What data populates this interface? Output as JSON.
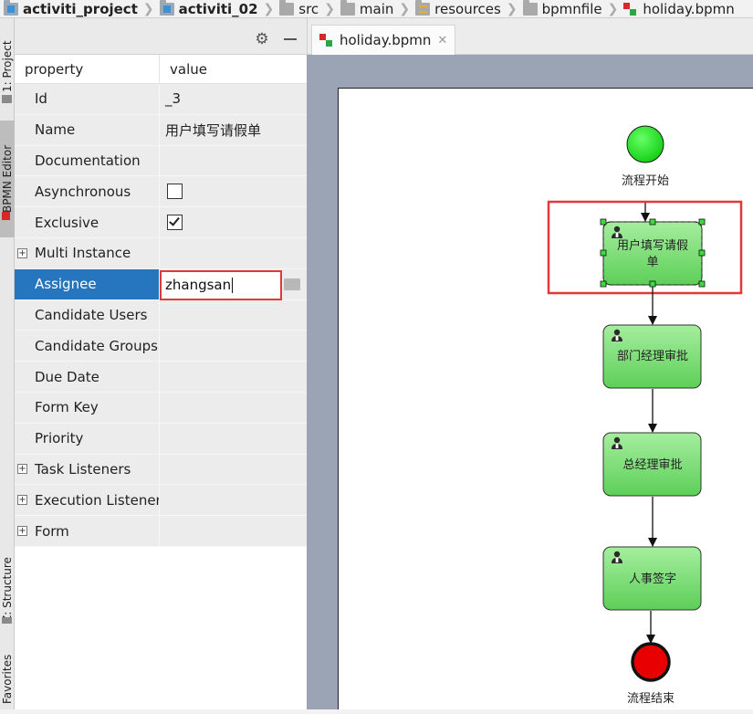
{
  "breadcrumb": {
    "items": [
      "activiti_project",
      "activiti_02",
      "src",
      "main",
      "resources",
      "bpmnfile",
      "holiday.bpmn"
    ]
  },
  "toolstrip": {
    "project_tab": "1: Project",
    "bpmn_editor_tab": "BPMN Editor",
    "structure_tab": "Z: Structure",
    "favorites_tab": "Favorites"
  },
  "properties": {
    "header_property": "property",
    "header_value": "value",
    "rows": [
      {
        "label": "Id",
        "value": "_3"
      },
      {
        "label": "Name",
        "value": "用户填写请假单"
      },
      {
        "label": "Documentation",
        "value": ""
      },
      {
        "label": "Asynchronous",
        "value": ""
      },
      {
        "label": "Exclusive",
        "value": ""
      },
      {
        "label": "Multi Instance",
        "value": ""
      },
      {
        "label": "Assignee",
        "value": "zhangsan"
      },
      {
        "label": "Candidate Users",
        "value": ""
      },
      {
        "label": "Candidate Groups",
        "value": ""
      },
      {
        "label": "Due Date",
        "value": ""
      },
      {
        "label": "Form Key",
        "value": ""
      },
      {
        "label": "Priority",
        "value": ""
      },
      {
        "label": "Task Listeners",
        "value": ""
      },
      {
        "label": "Execution Listeners",
        "value": ""
      },
      {
        "label": "Form",
        "value": ""
      }
    ],
    "asynchronous_checked": false,
    "exclusive_checked": true
  },
  "editor": {
    "tab_label": "holiday.bpmn"
  },
  "diagram": {
    "start_label": "流程开始",
    "task1_line1": "用户填写请假",
    "task1_line2": "单",
    "task2": "部门经理审批",
    "task3": "总经理审批",
    "task4": "人事签字",
    "end_label": "流程结束"
  },
  "colors": {
    "selection": "#2675bf",
    "highlight_red": "#e0393c",
    "task_green": "#7dd97a",
    "start_green": "#22dd22",
    "end_red": "#e80000"
  }
}
